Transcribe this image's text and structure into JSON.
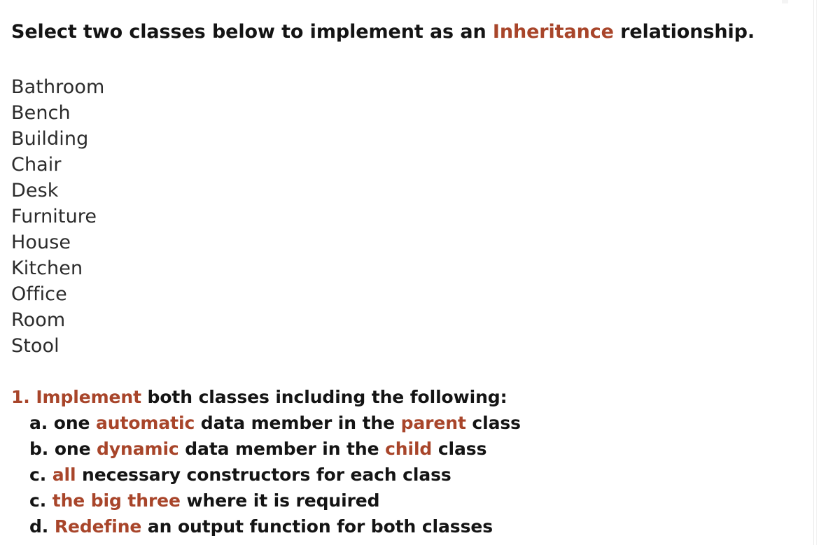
{
  "colors": {
    "accent": "#a8452a",
    "text": "#141414",
    "list_text": "#2b2b2b",
    "background": "#ffffff",
    "divider": "#e9e9e9"
  },
  "heading": {
    "before": "Select two classes below to implement as an ",
    "accent": "Inheritance",
    "after": " relationship."
  },
  "class_list": {
    "items": [
      "Bathroom",
      "Bench",
      "Building",
      "Chair",
      "Desk",
      "Furniture",
      "House",
      "Kitchen",
      "Office",
      "Room",
      "Stool"
    ]
  },
  "requirements": [
    {
      "marker": "1.",
      "marker_accent": true,
      "level": "top",
      "parts": [
        {
          "text": "Implement",
          "accent": true
        },
        {
          "text": " both classes including the following:",
          "accent": false
        }
      ]
    },
    {
      "marker": "a.",
      "marker_accent": false,
      "level": "sub",
      "parts": [
        {
          "text": "one ",
          "accent": false
        },
        {
          "text": "automatic",
          "accent": true
        },
        {
          "text": " data member in the ",
          "accent": false
        },
        {
          "text": "parent",
          "accent": true
        },
        {
          "text": " class",
          "accent": false
        }
      ]
    },
    {
      "marker": "b.",
      "marker_accent": false,
      "level": "sub",
      "parts": [
        {
          "text": "one ",
          "accent": false
        },
        {
          "text": "dynamic",
          "accent": true
        },
        {
          "text": " data member in the ",
          "accent": false
        },
        {
          "text": "child",
          "accent": true
        },
        {
          "text": " class",
          "accent": false
        }
      ]
    },
    {
      "marker": "c.",
      "marker_accent": false,
      "level": "sub",
      "parts": [
        {
          "text": "all",
          "accent": true
        },
        {
          "text": " necessary constructors for each class",
          "accent": false
        }
      ]
    },
    {
      "marker": "c.",
      "marker_accent": false,
      "level": "sub",
      "parts": [
        {
          "text": "the big three",
          "accent": true
        },
        {
          "text": " where it is required",
          "accent": false
        }
      ]
    },
    {
      "marker": "d.",
      "marker_accent": false,
      "level": "sub",
      "parts": [
        {
          "text": "Redefine",
          "accent": true
        },
        {
          "text": " an output function for both classes",
          "accent": false
        }
      ]
    }
  ]
}
